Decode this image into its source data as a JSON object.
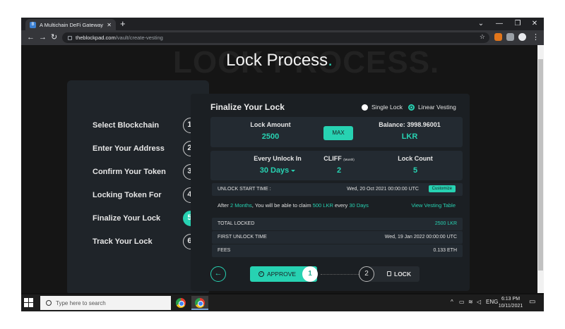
{
  "browser": {
    "tab_title": "A Multichain DeFi Gateway For T...",
    "new_tab": "+",
    "url_domain": "theblockpad.com",
    "url_path": "/vault/create-vesting",
    "controls": {
      "dropdown": "⌄",
      "minimize": "—",
      "restore": "❐",
      "close": "✕"
    },
    "nav": {
      "back": "←",
      "forward": "→",
      "reload": "↻"
    },
    "star": "☆",
    "menu": "⋮"
  },
  "page": {
    "background_word": "LOCK PROCESS.",
    "heading": "Lock Process",
    "heading_dot": ".",
    "steps": [
      {
        "label": "Select Blockchain",
        "num": "1."
      },
      {
        "label": "Enter Your Address",
        "num": "2."
      },
      {
        "label": "Confirm Your Token",
        "num": "3."
      },
      {
        "label": "Locking Token For",
        "num": "4."
      },
      {
        "label": "Finalize Your Lock",
        "num": "5."
      },
      {
        "label": "Track Your Lock",
        "num": "6."
      }
    ],
    "card": {
      "title": "Finalize Your Lock",
      "radio_single": "Single Lock",
      "radio_linear": "Linear Vesting",
      "lock_amount_label": "Lock Amount",
      "lock_amount_value": "2500",
      "max_label": "MAX",
      "balance_label": "Balance: 3998.96001",
      "balance_token": "LKR",
      "every_unlock_label": "Every Unlock In",
      "every_unlock_value": "30 Days",
      "cliff_label": "CLIFF",
      "cliff_unit": "(Month)",
      "cliff_value": "2",
      "lock_count_label": "Lock Count",
      "lock_count_value": "5",
      "unlock_start_label": "UNLOCK START TIME :",
      "unlock_start_value": "Wed, 20 Oct 2021 00:00:00 UTC",
      "customize_label": "Customize",
      "claim_prefix": "After ",
      "claim_months": "2 Months",
      "claim_mid": ", You will be able to claim ",
      "claim_amount": "500 LKR",
      "claim_every": " every ",
      "claim_days": "30 Days",
      "view_vesting": "View Vesting Table",
      "total_locked_label": "TOTAL LOCKED",
      "total_locked_value": "2500 LKR",
      "first_unlock_label": "FIRST UNLOCK TIME",
      "first_unlock_value": "Wed, 19 Jan 2022 00:00:00 UTC",
      "fees_label": "FEES",
      "fees_value": "0.133 ETH",
      "back_arrow": "←",
      "approve_label": "APPROVE",
      "approve_num": "1",
      "lock_num": "2",
      "lock_label": "LOCK"
    }
  },
  "taskbar": {
    "search_placeholder": "Type here to search",
    "language": "ENG",
    "time": "6:13 PM",
    "date": "10/11/2021",
    "tray_arrow": "^"
  },
  "colors": {
    "accent": "#27d2b2",
    "page_bg": "#151515",
    "card_bg": "#1b1f23"
  }
}
